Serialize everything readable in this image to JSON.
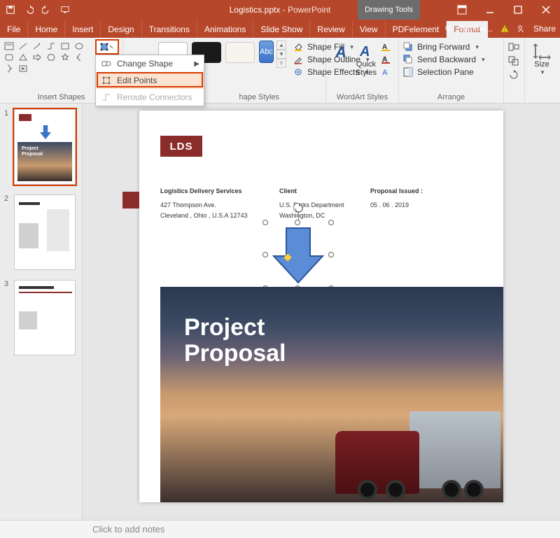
{
  "titlebar": {
    "filename": "Logistics.pptx",
    "appname": "PowerPoint",
    "context_tab": "Drawing Tools"
  },
  "tabs": {
    "file": "File",
    "home": "Home",
    "insert": "Insert",
    "design": "Design",
    "transitions": "Transitions",
    "animations": "Animations",
    "slideshow": "Slide Show",
    "review": "Review",
    "view": "View",
    "pdfelement": "PDFelement",
    "format": "Format",
    "tellme": "Tell me...",
    "share": "Share"
  },
  "ribbon": {
    "insert_shapes_label": "Insert Shapes",
    "shape_styles_label": "hape Styles",
    "wordart_styles_label": "WordArt Styles",
    "arrange_label": "Arrange",
    "size_label": "Size",
    "abc": "Abc",
    "shape_fill": "Shape Fill",
    "shape_outline": "Shape Outline",
    "shape_effects": "Shape Effects",
    "quick_styles": "Quick\nStyles",
    "bring_forward": "Bring Forward",
    "send_backward": "Send Backward",
    "selection_pane": "Selection Pane"
  },
  "dropdown": {
    "change_shape": "Change Shape",
    "edit_points": "Edit Points",
    "reroute": "Reroute Connectors"
  },
  "thumbs": {
    "n1": "1",
    "n2": "2",
    "n3": "3"
  },
  "slide": {
    "logo": "LDS",
    "col1_title": "Logistics Delivery Services",
    "col1_l1": "427 Thompson Ave.",
    "col1_l2": "Cleveland , Ohio , U.S.A 12743",
    "col2_title": "Client",
    "col2_l1": "U.S. Parks Department",
    "col2_l2": "Washington, DC",
    "col3_title": "Proposal Issued :",
    "col3_l1": "05 . 06 . 2019",
    "project": "Project",
    "proposal": "Proposal"
  },
  "notes": {
    "placeholder": "Click to add notes"
  }
}
